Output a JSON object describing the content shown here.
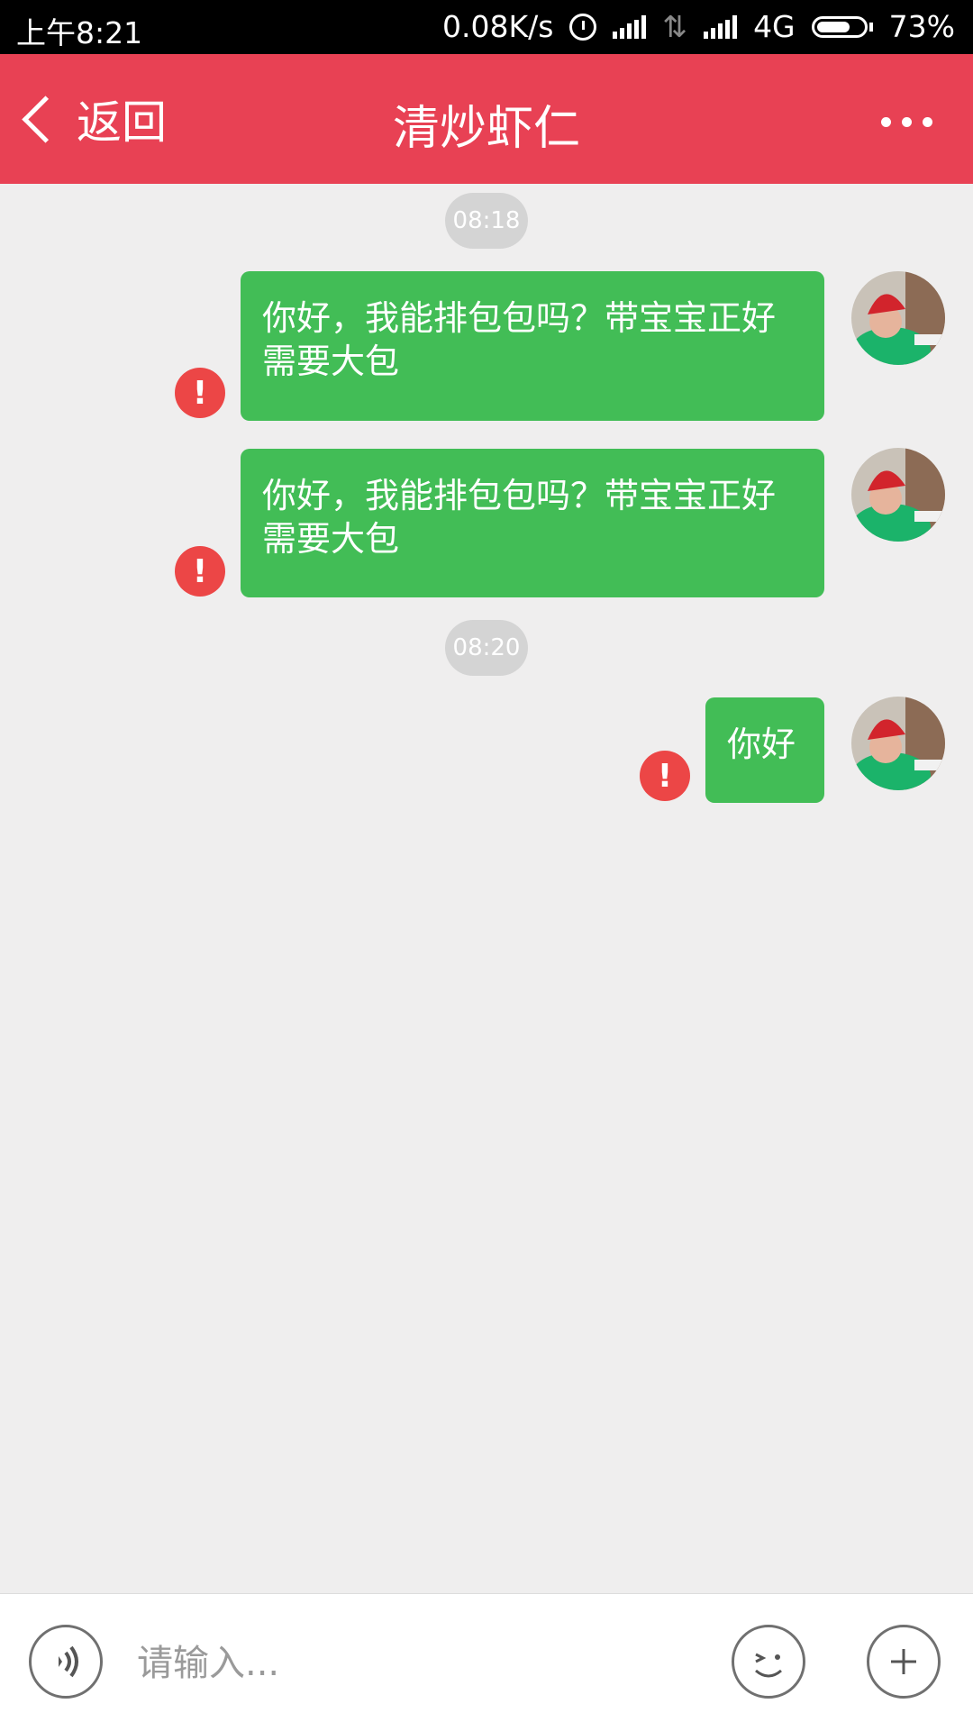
{
  "status_bar": {
    "time": "上午8:21",
    "net_speed": "0.08K/s",
    "network": "4G",
    "battery": "73%",
    "battery_level": 0.73,
    "icons": [
      "alarm-icon",
      "signal-icon",
      "data-transfer-icon",
      "signal-icon"
    ]
  },
  "header": {
    "back_label": "返回",
    "title": "清炒虾仁",
    "background_color": "#e84154",
    "more_icon": "more-dots-icon"
  },
  "messages": [
    {
      "type": "time",
      "text": "08:18"
    },
    {
      "type": "outgoing",
      "text": "你好，我能排包包吗？带宝宝正好需要大包",
      "status": "failed"
    },
    {
      "type": "outgoing",
      "text": "你好，我能排包包吗？带宝宝正好需要大包",
      "status": "failed"
    },
    {
      "type": "time",
      "text": "08:20"
    },
    {
      "type": "outgoing",
      "text": "你好",
      "status": "failed"
    }
  ],
  "colors": {
    "bubble": "#42bd56",
    "error": "#ec4646",
    "background": "#efeeee"
  },
  "input_bar": {
    "placeholder": "请输入...",
    "voice_icon": "voice-icon",
    "emoji_icon": "emoji-icon",
    "plus_icon": "plus-icon"
  }
}
